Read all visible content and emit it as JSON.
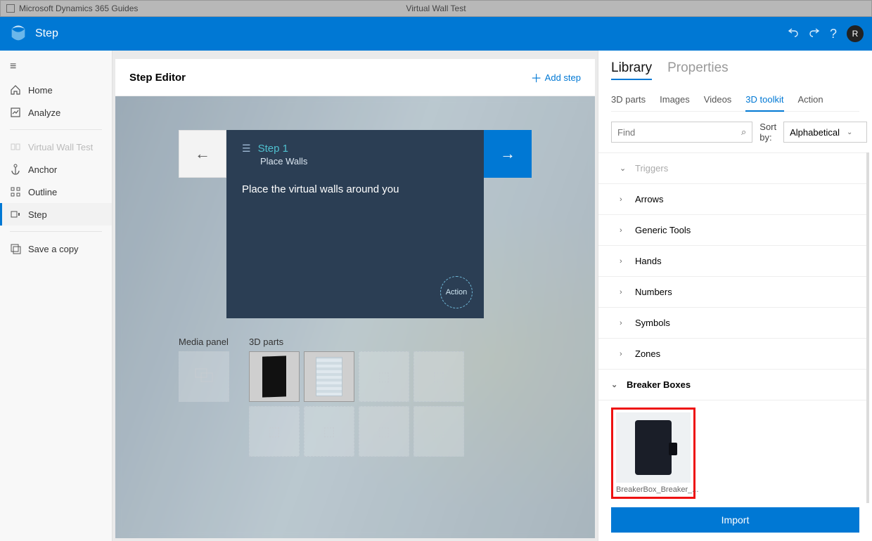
{
  "titlebar": {
    "app_name": "Microsoft Dynamics 365 Guides",
    "doc_name": "Virtual Wall Test"
  },
  "header": {
    "title": "Step"
  },
  "sidebar": {
    "home": "Home",
    "analyze": "Analyze",
    "guide_name": "Virtual Wall Test",
    "anchor": "Anchor",
    "outline": "Outline",
    "step": "Step",
    "save_copy": "Save a copy"
  },
  "editor": {
    "title": "Step Editor",
    "add_step": "Add step",
    "step_number": "Step 1",
    "step_title": "Place Walls",
    "instruction": "Place the virtual walls around you",
    "action_label": "Action",
    "media_panel_label": "Media panel",
    "parts_label": "3D parts"
  },
  "library": {
    "tabs": {
      "library": "Library",
      "properties": "Properties"
    },
    "subtabs": {
      "parts": "3D parts",
      "images": "Images",
      "videos": "Videos",
      "toolkit": "3D toolkit",
      "action": "Action"
    },
    "find_placeholder": "Find",
    "sort_label": "Sort by:",
    "sort_value": "Alphabetical",
    "categories": {
      "triggers": "Triggers",
      "arrows": "Arrows",
      "generic_tools": "Generic Tools",
      "hands": "Hands",
      "numbers": "Numbers",
      "symbols": "Symbols",
      "zones": "Zones",
      "breaker_boxes": "Breaker Boxes"
    },
    "asset_name": "BreakerBox_Breaker_...",
    "import_label": "Import"
  }
}
